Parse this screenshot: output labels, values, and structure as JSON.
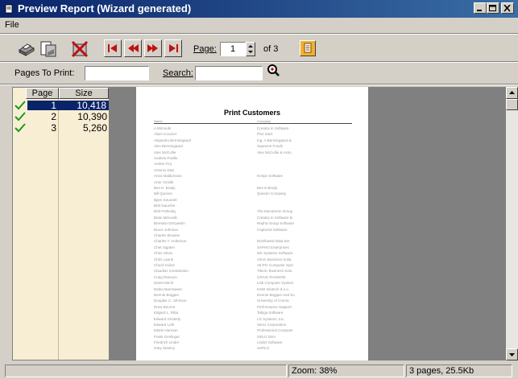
{
  "window": {
    "title": "Preview Report (Wizard generated)"
  },
  "menu": {
    "file": "File"
  },
  "toolbar": {
    "page_label": "Page:",
    "page_value": "1",
    "of_label": "of 3",
    "pages_to_print_label": "Pages To Print:",
    "search_label": "Search:",
    "pages_to_print_value": "",
    "search_value": ""
  },
  "pages_list": {
    "headers": {
      "page": "Page",
      "size": "Size"
    },
    "rows": [
      {
        "page": "1",
        "size": "10,418",
        "selected": true
      },
      {
        "page": "2",
        "size": "10,390",
        "selected": false
      },
      {
        "page": "3",
        "size": "5,260",
        "selected": false
      }
    ]
  },
  "report": {
    "title": "Print Customers",
    "columns": [
      "Name",
      "Company"
    ],
    "rows": [
      [
        "A Mirnoulk",
        "Creatrix in Software"
      ],
      [
        "Alain Crouzier",
        "PS2 Start"
      ],
      [
        "Alejandro Bermingaard",
        "Ing. A.Bermingaard &"
      ],
      [
        "Alex Bermingaard",
        "Supreme Foods"
      ],
      [
        "Alex McCullie",
        "Alex McCullie & Assn."
      ],
      [
        "Andrew Faville",
        ""
      ],
      [
        "Andrei Troj",
        ""
      ],
      [
        "Antonio Diaz",
        ""
      ],
      [
        "Arnor Baldursson",
        "Kreipe Software"
      ],
      [
        "Artur Cieslik",
        ""
      ],
      [
        "Ben E. Brady",
        "Ben E.Brady"
      ],
      [
        "Bill Quesnn",
        "Quesnn Company"
      ],
      [
        "Björn Keurentl",
        ""
      ],
      [
        "Britt Gaucher",
        ""
      ],
      [
        "Britt Fethesky",
        "The Monoterrin Group"
      ],
      [
        "Brian Mirnoulk",
        "Creatrix in Software B."
      ],
      [
        "Brendon DeGaetrin",
        "Repha Group Software"
      ],
      [
        "Bruce Johnson",
        "Captured Software"
      ],
      [
        "Charles Browne",
        ""
      ],
      [
        "Charles T. Anderson",
        "Distributed Data Ser"
      ],
      [
        "Chet Sigaten",
        "SAPHO Enterprises"
      ],
      [
        "Chris Hines",
        "MC Systems Software"
      ],
      [
        "Chris Laurie",
        "Aimm Business Solut."
      ],
      [
        "Chuck Kulisz",
        "Att.Prn Computer Syst"
      ],
      [
        "Claudius Constantinu",
        "Tiberic Business Solu."
      ],
      [
        "Craig Ransom",
        "CRAIG RANSOM"
      ],
      [
        "Daniel Birch",
        "Link Computer System"
      ],
      [
        "Darko Barnsaevic",
        "KSW Infotech d.o.o."
      ],
      [
        "Dennie Beggen",
        "Dennie Beggen And So"
      ],
      [
        "Douglas C. Johnson",
        "University of Crema"
      ],
      [
        "Drew Bourne",
        "Performance Support"
      ],
      [
        "Edgard L. Riba",
        "Tabiga Software"
      ],
      [
        "Edward Gristerly",
        "LG Systems, Inc."
      ],
      [
        "Edward Loth",
        "Verox Corporation"
      ],
      [
        "Edwin Harman",
        "Professional Compute"
      ],
      [
        "Frank Geslinger",
        "GELO Dsm"
      ],
      [
        "Friedrich Linder",
        "Linder Software"
      ],
      [
        "Gary Stanley",
        "SSPLO"
      ]
    ]
  },
  "status": {
    "left": "",
    "zoom": "Zoom: 38%",
    "info": "3 pages, 25.5Kb"
  },
  "colors": {
    "title_start": "#0a246a",
    "title_end": "#3a6ea5",
    "list_bg": "#f8eed4",
    "selection": "#0a246a",
    "check": "#1a9a1a"
  }
}
